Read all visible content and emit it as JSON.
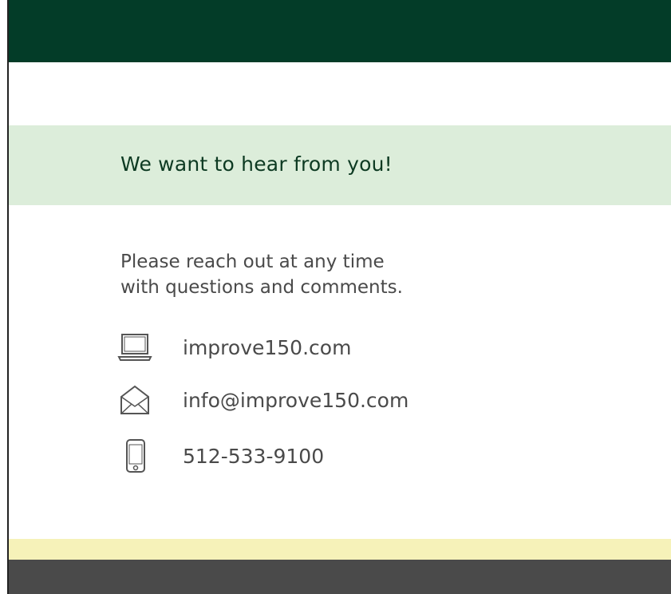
{
  "header": {
    "title": "We want to hear from you!"
  },
  "intro": {
    "line1": "Please reach out at any time",
    "line2": "with questions and comments."
  },
  "contacts": [
    {
      "icon": "laptop-icon",
      "text": "improve150.com"
    },
    {
      "icon": "envelope-icon",
      "text": "info@improve150.com"
    },
    {
      "icon": "phone-icon",
      "text": "512-533-9100"
    }
  ],
  "colors": {
    "top_band": "#033c28",
    "header_band": "#dcedda",
    "heading_text": "#0d3a22",
    "body_text": "#4a4a4a",
    "yellow_band": "#f6f2b9",
    "bottom_band": "#4a4a4a"
  }
}
